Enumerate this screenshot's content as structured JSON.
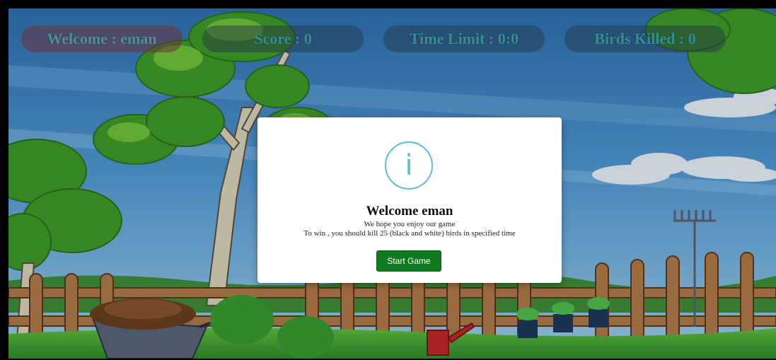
{
  "hud": {
    "welcome": "Welcome : eman",
    "score": "Score : 0",
    "time_limit": "Time Limit : 0:0",
    "birds_killed": "Birds Killed : 0"
  },
  "modal": {
    "icon": "info-icon",
    "icon_glyph": "i",
    "title": "Welcome eman",
    "line1": "We hope you enjoy our game",
    "line2": "To win , you should kill 25 (black and white) birds in specified time",
    "start_button_label": "Start Game"
  },
  "colors": {
    "sky": "#3f86c8",
    "grass": "#4fae3a",
    "fence": "#b07a4a",
    "info_accent": "#5bbcd6",
    "start_button": "#0f7a1e",
    "hud_text": "#3aa3a8"
  }
}
